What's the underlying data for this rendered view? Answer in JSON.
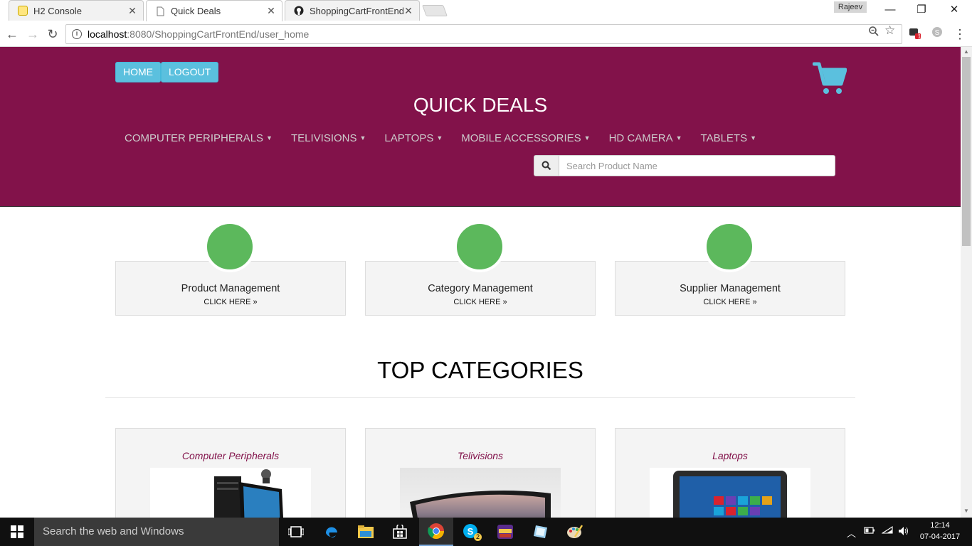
{
  "browser": {
    "tabs": [
      {
        "title": "H2 Console",
        "close": "✕"
      },
      {
        "title": "Quick Deals",
        "close": "✕"
      },
      {
        "title": "ShoppingCartFrontEndM",
        "close": "✕"
      }
    ],
    "profile_name": "Rajeev",
    "url_host": "localhost",
    "url_rest": ":8080/ShoppingCartFrontEnd/user_home",
    "extension_badge": "1"
  },
  "header": {
    "home_label": "HOME",
    "logout_label": "LOGOUT",
    "site_title": "QUICK DEALS",
    "categories": [
      "COMPUTER PERIPHERALS",
      "TELIVISIONS",
      "LAPTOPS",
      "MOBILE ACCESSORIES",
      "HD CAMERA",
      "TABLETS"
    ],
    "search_placeholder": "Search Product Name"
  },
  "management": [
    {
      "title": "Product Management",
      "link": "CLICK HERE »"
    },
    {
      "title": "Category Management",
      "link": "CLICK HERE »"
    },
    {
      "title": "Supplier Management",
      "link": "CLICK HERE »"
    }
  ],
  "top_categories": {
    "title": "TOP CATEGORIES",
    "items": [
      "Computer Peripherals",
      "Telivisions",
      "Laptops"
    ]
  },
  "taskbar": {
    "search_text": "Search the web and Windows",
    "time": "12:14",
    "date": "07-04-2017",
    "skype_badge": "2"
  },
  "colors": {
    "header_bg": "#82124a",
    "button_bg": "#5bc0de",
    "circle": "#5cb85c",
    "category_text": "#82124a"
  }
}
